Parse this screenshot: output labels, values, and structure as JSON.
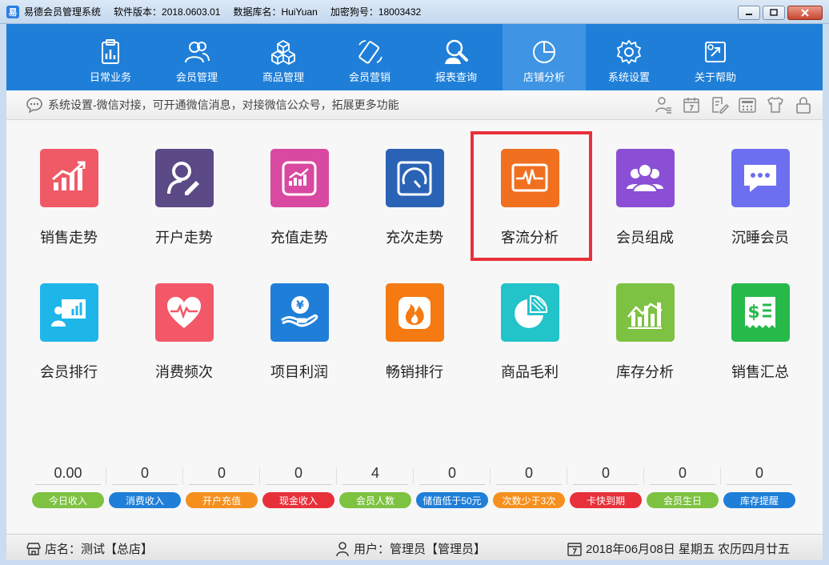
{
  "window": {
    "app_name": "易德会员管理系统",
    "version": "软件版本：2018.0603.01",
    "database": "数据库名：HuiYuan",
    "dongle": "加密狗号：18003432"
  },
  "nav": [
    {
      "label": "日常业务",
      "icon": "clipboard-chart-icon"
    },
    {
      "label": "会员管理",
      "icon": "users-icon"
    },
    {
      "label": "商品管理",
      "icon": "cubes-icon"
    },
    {
      "label": "会员营销",
      "icon": "mobile-icon"
    },
    {
      "label": "报表查询",
      "icon": "search-person-icon"
    },
    {
      "label": "店铺分析",
      "icon": "pie-chart-icon",
      "active": true
    },
    {
      "label": "系统设置",
      "icon": "gear-icon"
    },
    {
      "label": "关于帮助",
      "icon": "help-icon"
    }
  ],
  "notice": {
    "text": "系统设置-微信对接，可开通微信消息，对接微信公众号，拓展更多功能"
  },
  "tiles_row1": [
    {
      "label": "销售走势",
      "color": "#f05a67"
    },
    {
      "label": "开户走势",
      "color": "#5b4a86"
    },
    {
      "label": "充值走势",
      "color": "#d949a1"
    },
    {
      "label": "充次走势",
      "color": "#2a63b5"
    },
    {
      "label": "客流分析",
      "color": "#f07020"
    },
    {
      "label": "会员组成",
      "color": "#8b4fd6"
    },
    {
      "label": "沉睡会员",
      "color": "#6c6ff0"
    }
  ],
  "tiles_row2": [
    {
      "label": "会员排行",
      "color": "#1eb6e8"
    },
    {
      "label": "消费频次",
      "color": "#f25868"
    },
    {
      "label": "项目利润",
      "color": "#1f7fd8"
    },
    {
      "label": "畅销排行",
      "color": "#f57a12"
    },
    {
      "label": "商品毛利",
      "color": "#22c3c9"
    },
    {
      "label": "库存分析",
      "color": "#7dc242"
    },
    {
      "label": "销售汇总",
      "color": "#27b94a"
    }
  ],
  "stats": [
    {
      "value": "0.00",
      "label": "今日收入",
      "color": "#7ec242"
    },
    {
      "value": "0",
      "label": "消费收入",
      "color": "#1f7fd8"
    },
    {
      "value": "0",
      "label": "开户充值",
      "color": "#f5901e"
    },
    {
      "value": "0",
      "label": "现金收入",
      "color": "#e8303a"
    },
    {
      "value": "4",
      "label": "会员人数",
      "color": "#7ec242"
    },
    {
      "value": "0",
      "label": "储值低于50元",
      "color": "#1f7fd8"
    },
    {
      "value": "0",
      "label": "次数少于3次",
      "color": "#f5901e"
    },
    {
      "value": "0",
      "label": "卡快到期",
      "color": "#e8303a"
    },
    {
      "value": "0",
      "label": "会员生日",
      "color": "#7ec242"
    },
    {
      "value": "0",
      "label": "库存提醒",
      "color": "#1f7fd8"
    }
  ],
  "status": {
    "store": "店名：测试【总店】",
    "user": "用户：管理员【管理员】",
    "date": "2018年06月08日 星期五 农历四月廿五"
  }
}
